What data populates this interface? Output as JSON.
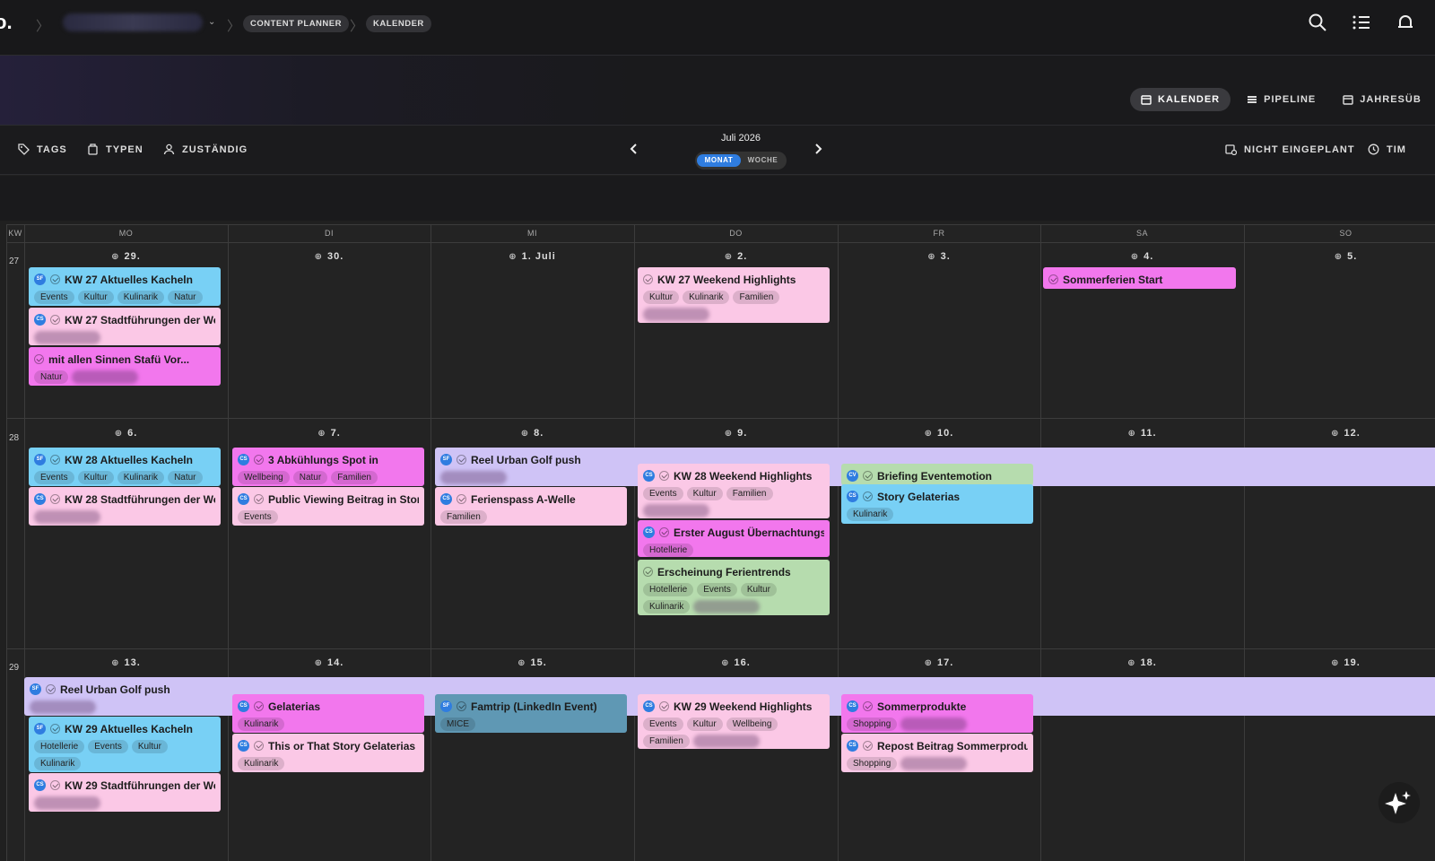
{
  "topbar": {
    "logo": "o.",
    "breadcrumbs": [
      "CONTENT PLANNER",
      "KALENDER"
    ]
  },
  "views": [
    {
      "label": "KALENDER",
      "icon": "calendar-icon",
      "active": true
    },
    {
      "label": "PIPELINE",
      "icon": "pipeline-icon",
      "active": false
    },
    {
      "label": "JAHRESÜB",
      "icon": "year-calendar-icon",
      "active": false
    }
  ],
  "filters": {
    "tags": "TAGS",
    "types": "TYPEN",
    "assignee": "ZUSTÄNDIG",
    "unscheduled": "NICHT EINGEPLANT",
    "timeline": "TIM"
  },
  "month": {
    "label": "Juli 2026",
    "modes": [
      "MONAT",
      "WOCHE"
    ],
    "active_mode": "MONAT"
  },
  "weekdays": [
    "MO",
    "DI",
    "MI",
    "DO",
    "FR",
    "SA",
    "SO"
  ],
  "kw_label": "KW",
  "weeks": [
    {
      "kw": "27",
      "days": [
        "29.",
        "30.",
        "1. Juli",
        "2.",
        "3.",
        "4.",
        "5."
      ]
    },
    {
      "kw": "28",
      "days": [
        "6.",
        "7.",
        "8.",
        "9.",
        "10.",
        "11.",
        "12."
      ]
    },
    {
      "kw": "29",
      "days": [
        "13.",
        "14.",
        "15.",
        "16.",
        "17.",
        "18.",
        "19."
      ]
    }
  ],
  "colors": {
    "blue": "#78d0f5",
    "pink": "#fbc8e6",
    "magenta": "#f277ed",
    "green": "#b6dcae",
    "lavender": "#cfc3f6",
    "teal": "#5f98b4",
    "accent": "#2f7de0"
  },
  "events": [
    {
      "id": "e1",
      "title": "KW 27 Aktuelles Kacheln",
      "badge": "SF",
      "tags": [
        "Events",
        "Kultur",
        "Kulinarik",
        "Natur"
      ]
    },
    {
      "id": "e2",
      "title": "KW 27 Stadtführungen der Wo...",
      "badge": "CS",
      "tags": []
    },
    {
      "id": "e3",
      "title": "mit allen Sinnen Stafü Vor...",
      "badge": "",
      "tags": [
        "Natur"
      ]
    },
    {
      "id": "e4",
      "title": "KW 27 Weekend Highlights",
      "badge": "",
      "tags": [
        "Kultur",
        "Kulinarik",
        "Familien"
      ]
    },
    {
      "id": "e5",
      "title": "Sommerferien Start",
      "badge": "",
      "tags": []
    },
    {
      "id": "e6",
      "title": "KW 28 Aktuelles Kacheln",
      "badge": "SF",
      "tags": [
        "Events",
        "Kultur",
        "Kulinarik",
        "Natur"
      ]
    },
    {
      "id": "e7",
      "title": "KW 28 Stadtführungen der Wo...",
      "badge": "CS",
      "tags": []
    },
    {
      "id": "e8",
      "title": "3 Abkühlungs Spot in",
      "badge": "CS",
      "tags": [
        "Wellbeing",
        "Natur",
        "Familien"
      ]
    },
    {
      "id": "e9",
      "title": "Public Viewing Beitrag in Stor...",
      "badge": "CS",
      "tags": [
        "Events"
      ]
    },
    {
      "id": "e10",
      "title": "Reel Urban Golf push",
      "badge": "SF",
      "tags": []
    },
    {
      "id": "e11",
      "title": "Ferienspass A-Welle",
      "badge": "CS",
      "tags": [
        "Familien"
      ]
    },
    {
      "id": "e12",
      "title": "KW 28 Weekend Highlights",
      "badge": "CS",
      "tags": [
        "Events",
        "Kultur",
        "Familien"
      ]
    },
    {
      "id": "e13",
      "title": "Erster August Übernachtungs...",
      "badge": "CS",
      "tags": [
        "Hotellerie"
      ]
    },
    {
      "id": "e14",
      "title": "Erscheinung Ferientrends",
      "badge": "",
      "tags": [
        "Hotellerie",
        "Events",
        "Kultur",
        "Kulinarik"
      ]
    },
    {
      "id": "e15",
      "title": "Briefing Eventemotion",
      "badge": "CV",
      "tags": []
    },
    {
      "id": "e16",
      "title": "Story Gelaterias",
      "badge": "CS",
      "tags": [
        "Kulinarik"
      ]
    },
    {
      "id": "e17",
      "title": "Reel Urban Golf push",
      "badge": "SF",
      "tags": []
    },
    {
      "id": "e18",
      "title": "KW 29 Aktuelles Kacheln",
      "badge": "SF",
      "tags": [
        "Hotellerie",
        "Events",
        "Kultur",
        "Kulinarik"
      ]
    },
    {
      "id": "e19",
      "title": "KW 29 Stadtführungen der Wo...",
      "badge": "CS",
      "tags": []
    },
    {
      "id": "e20",
      "title": "Gelaterias",
      "badge": "CS",
      "tags": [
        "Kulinarik"
      ]
    },
    {
      "id": "e21",
      "title": "This or That Story Gelaterias",
      "badge": "CS",
      "tags": [
        "Kulinarik"
      ]
    },
    {
      "id": "e22",
      "title": "Famtrip (LinkedIn Event)",
      "badge": "SF",
      "tags": [
        "MICE"
      ]
    },
    {
      "id": "e23",
      "title": "KW 29 Weekend Highlights",
      "badge": "CS",
      "tags": [
        "Events",
        "Kultur",
        "Wellbeing",
        "Familien"
      ]
    },
    {
      "id": "e24",
      "title": "Sommerprodukte",
      "badge": "CS",
      "tags": [
        "Shopping"
      ]
    },
    {
      "id": "e25",
      "title": "Repost Beitrag Sommerprodu...",
      "badge": "CS",
      "tags": [
        "Shopping"
      ]
    }
  ]
}
